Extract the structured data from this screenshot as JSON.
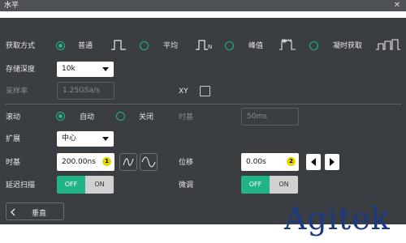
{
  "dialog": {
    "title": "水平",
    "close_icon": "close-icon"
  },
  "acquisition": {
    "label": "获取方式",
    "options": [
      {
        "label": "普通",
        "selected": true
      },
      {
        "label": "平均",
        "selected": false
      },
      {
        "label": "峰值",
        "selected": false
      },
      {
        "label": "凝时获取",
        "selected": false
      }
    ]
  },
  "memory_depth": {
    "label": "存储深度",
    "value": "10k"
  },
  "sample_rate": {
    "label": "采样率",
    "value": "1.25GSa/s"
  },
  "xy": {
    "label": "XY",
    "checked": false
  },
  "roll": {
    "label": "滚动",
    "options": [
      {
        "label": "自动",
        "selected": true
      },
      {
        "label": "关闭",
        "selected": false
      }
    ],
    "timebase_label": "时基",
    "timebase_value": "50ms"
  },
  "expand": {
    "label": "扩展",
    "value": "中心"
  },
  "timebase": {
    "label": "时基",
    "value": "200.00ns",
    "badge": "1"
  },
  "position": {
    "label": "位移",
    "value": "0.00s",
    "badge": "2"
  },
  "delayed_scan": {
    "label": "延迟扫描",
    "off_label": "OFF",
    "on_label": "ON",
    "state": "OFF"
  },
  "fine_tune": {
    "label": "微调",
    "off_label": "OFF",
    "on_label": "ON",
    "state": "OFF"
  },
  "vertical_button": {
    "label": "垂直"
  },
  "watermark": "Agitek",
  "colors": {
    "panel": "#3a3d41",
    "title": "#4e5257",
    "accent": "#21b489",
    "badge": "#e6d600",
    "watermark": "#1b3a86"
  }
}
